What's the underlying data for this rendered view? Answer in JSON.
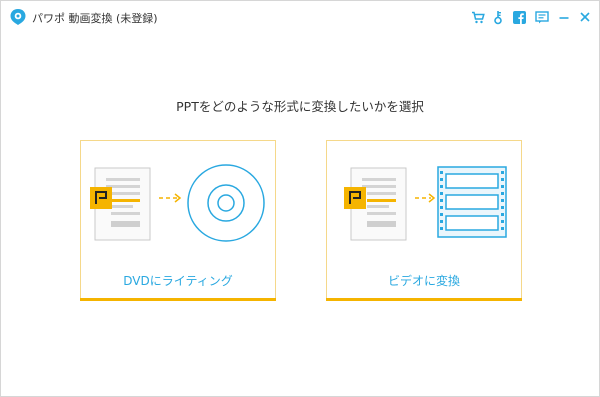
{
  "app": {
    "title": "パワポ 動画変換 (未登録)"
  },
  "titlebar": {
    "icons": [
      "cart-icon",
      "key-icon",
      "facebook-icon",
      "feedback-icon",
      "minimize-icon",
      "close-icon"
    ]
  },
  "main": {
    "heading": "PPTをどのような形式に変換したいかを選択"
  },
  "cards": [
    {
      "label": "DVDにライティング",
      "icon": "dvd-disc-icon"
    },
    {
      "label": "ビデオに変換",
      "icon": "video-film-icon"
    }
  ],
  "colors": {
    "accent_blue": "#29a8e0",
    "accent_yellow": "#f5b400",
    "card_border": "#f5d88a"
  }
}
